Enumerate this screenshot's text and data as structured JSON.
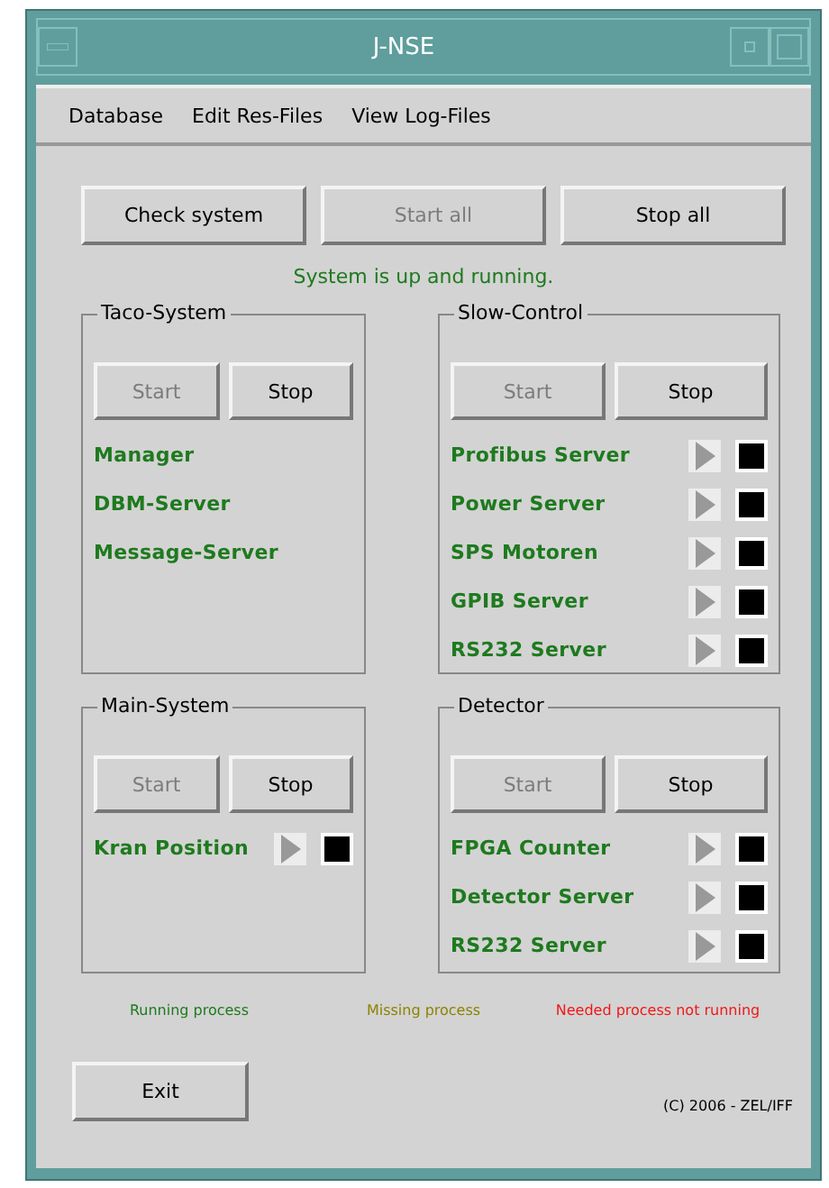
{
  "window": {
    "title": "J-NSE"
  },
  "menu": [
    "Database",
    "Edit Res-Files",
    "View Log-Files"
  ],
  "toolbar": [
    {
      "label": "Check system",
      "disabled": false
    },
    {
      "label": "Start all",
      "disabled": true
    },
    {
      "label": "Stop all",
      "disabled": false
    }
  ],
  "status": "System is up and running.",
  "groups": [
    {
      "title": "Taco-System",
      "buttons": [
        {
          "label": "Start",
          "disabled": true
        },
        {
          "label": "Stop",
          "disabled": false
        }
      ],
      "processes": [
        {
          "name": "Manager",
          "controls": false
        },
        {
          "name": "DBM-Server",
          "controls": false
        },
        {
          "name": "Message-Server",
          "controls": false
        }
      ]
    },
    {
      "title": "Slow-Control",
      "buttons": [
        {
          "label": "Start",
          "disabled": true
        },
        {
          "label": "Stop",
          "disabled": false
        }
      ],
      "processes": [
        {
          "name": "Profibus Server",
          "controls": true
        },
        {
          "name": "Power Server",
          "controls": true
        },
        {
          "name": "SPS Motoren",
          "controls": true
        },
        {
          "name": "GPIB Server",
          "controls": true
        },
        {
          "name": "RS232 Server",
          "controls": true
        }
      ]
    },
    {
      "title": "Main-System",
      "buttons": [
        {
          "label": "Start",
          "disabled": true
        },
        {
          "label": "Stop",
          "disabled": false
        }
      ],
      "processes": [
        {
          "name": "Kran Position",
          "controls": true
        }
      ]
    },
    {
      "title": "Detector",
      "buttons": [
        {
          "label": "Start",
          "disabled": true
        },
        {
          "label": "Stop",
          "disabled": false
        }
      ],
      "processes": [
        {
          "name": "FPGA Counter",
          "controls": true
        },
        {
          "name": "Detector Server",
          "controls": true
        },
        {
          "name": "RS232 Server",
          "controls": true
        }
      ]
    }
  ],
  "legend": [
    {
      "label": "Running process",
      "color": "#1e7a1e"
    },
    {
      "label": "Missing process",
      "color": "#8c8400"
    },
    {
      "label": "Needed process not running",
      "color": "#f01818"
    }
  ],
  "exit": "Exit",
  "copyright": "(C) 2006 - ZEL/IFF"
}
